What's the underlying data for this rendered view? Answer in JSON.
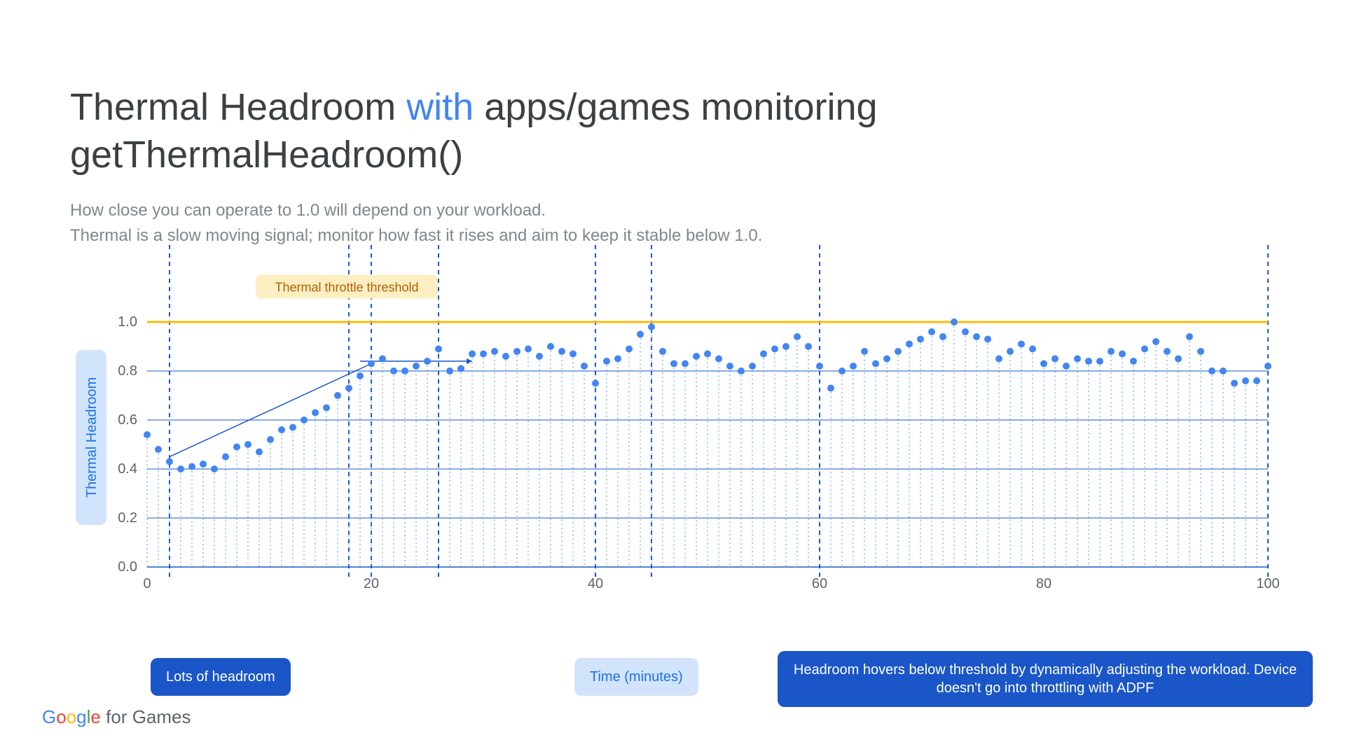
{
  "title_before": "Thermal Headroom ",
  "title_accent": "with",
  "title_after": " apps/games monitoring getThermalHeadroom()",
  "subtitle_line1": "How close you can operate to 1.0 will depend on your workload.",
  "subtitle_line2": "Thermal is a slow moving signal; monitor how fast it rises and aim to keep it stable below 1.0.",
  "ylabel": "Thermal Headroom",
  "xlabel": "Time (minutes)",
  "threshold_label": "Thermal throttle threshold",
  "annotation_left": "Lots of headroom",
  "annotation_right": "Headroom hovers below threshold by dynamically adjusting the workload. Device doesn't go into throttling with ADPF",
  "footer_rest": " for Games",
  "chart_data": {
    "type": "scatter",
    "title": "Thermal Headroom over time",
    "xlabel": "Time (minutes)",
    "ylabel": "Thermal Headroom",
    "xlim": [
      0,
      100
    ],
    "ylim": [
      0,
      1.2
    ],
    "xticks": [
      0,
      20,
      40,
      60,
      80,
      100
    ],
    "yticks": [
      0.0,
      0.2,
      0.4,
      0.6,
      0.8,
      1.0
    ],
    "threshold": 1.0,
    "region_dividers_x": [
      2,
      18,
      20,
      26,
      40,
      45,
      60,
      100
    ],
    "series": [
      {
        "name": "Thermal Headroom",
        "values": [
          0.54,
          0.48,
          0.43,
          0.4,
          0.41,
          0.42,
          0.4,
          0.45,
          0.49,
          0.5,
          0.47,
          0.52,
          0.56,
          0.57,
          0.6,
          0.63,
          0.65,
          0.7,
          0.73,
          0.78,
          0.83,
          0.85,
          0.8,
          0.8,
          0.82,
          0.84,
          0.89,
          0.8,
          0.81,
          0.87,
          0.87,
          0.88,
          0.86,
          0.88,
          0.89,
          0.86,
          0.9,
          0.88,
          0.87,
          0.82,
          0.75,
          0.84,
          0.85,
          0.89,
          0.95,
          0.98,
          0.88,
          0.83,
          0.83,
          0.86,
          0.87,
          0.85,
          0.82,
          0.8,
          0.82,
          0.87,
          0.89,
          0.9,
          0.94,
          0.9,
          0.82,
          0.73,
          0.8,
          0.82,
          0.88,
          0.83,
          0.85,
          0.88,
          0.91,
          0.93,
          0.96,
          0.94,
          1.0,
          0.96,
          0.94,
          0.93,
          0.85,
          0.88,
          0.91,
          0.89,
          0.83,
          0.85,
          0.82,
          0.85,
          0.84,
          0.84,
          0.88,
          0.87,
          0.84,
          0.89,
          0.92,
          0.88,
          0.85,
          0.94,
          0.88,
          0.8,
          0.8,
          0.75,
          0.76,
          0.76,
          0.82
        ]
      }
    ]
  }
}
